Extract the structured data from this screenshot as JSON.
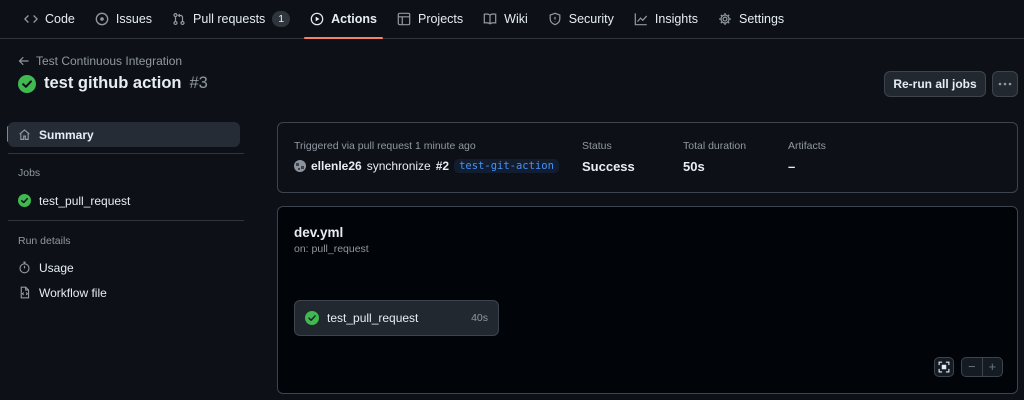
{
  "nav": {
    "tabs": [
      {
        "label": "Code",
        "icon": "code-icon"
      },
      {
        "label": "Issues",
        "icon": "issue-icon"
      },
      {
        "label": "Pull requests",
        "icon": "pull-request-icon",
        "count": "1"
      },
      {
        "label": "Actions",
        "icon": "play-icon",
        "selected": true
      },
      {
        "label": "Projects",
        "icon": "table-icon"
      },
      {
        "label": "Wiki",
        "icon": "book-icon"
      },
      {
        "label": "Security",
        "icon": "shield-icon"
      },
      {
        "label": "Insights",
        "icon": "graph-icon"
      },
      {
        "label": "Settings",
        "icon": "gear-icon"
      }
    ]
  },
  "header": {
    "back_label": "Test Continuous Integration",
    "title": "test github action",
    "run_number": "#3",
    "rerun_label": "Re-run all jobs",
    "more_label": "···"
  },
  "sidebar": {
    "summary_label": "Summary",
    "jobs_heading": "Jobs",
    "jobs": [
      {
        "label": "test_pull_request",
        "status": "success"
      }
    ],
    "run_details_heading": "Run details",
    "usage_label": "Usage",
    "workflow_file_label": "Workflow file"
  },
  "summary": {
    "triggered_label": "Triggered via pull request 1 minute ago",
    "actor": "ellenle26",
    "action": "synchronize",
    "pr_number": "#2",
    "branch": "test-git-action",
    "status_label": "Status",
    "status_value": "Success",
    "duration_label": "Total duration",
    "duration_value": "50s",
    "artifacts_label": "Artifacts",
    "artifacts_value": "–"
  },
  "workflow": {
    "file": "dev.yml",
    "on": "on: pull_request",
    "job": {
      "name": "test_pull_request",
      "duration": "40s"
    },
    "zoom_out": "−",
    "zoom_in": "+"
  },
  "colors": {
    "success": "#3fb950",
    "accent_underline": "#f78166",
    "link": "#4493f8",
    "background": "#0d1117"
  }
}
